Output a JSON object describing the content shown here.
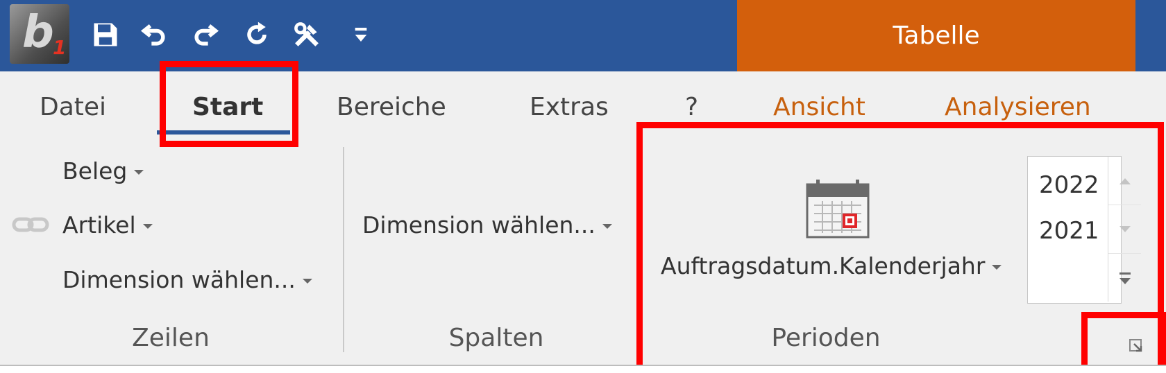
{
  "title_bar": {
    "logo_text": "b",
    "logo_sub": "1",
    "quick_access": [
      {
        "name": "save-icon"
      },
      {
        "name": "undo-icon"
      },
      {
        "name": "redo-icon"
      },
      {
        "name": "refresh-icon"
      },
      {
        "name": "tools-icon"
      },
      {
        "name": "customize-qat-icon"
      }
    ],
    "context_tab": "Tabelle"
  },
  "ribbon_tabs": [
    "Datei",
    "Start",
    "Bereiche",
    "Extras",
    "?",
    "Ansicht",
    "Analysieren"
  ],
  "active_tab": "Start",
  "groups": {
    "zeilen": {
      "title": "Zeilen",
      "items": [
        "Beleg",
        "Artikel",
        "Dimension wählen..."
      ]
    },
    "spalten": {
      "title": "Spalten",
      "items": [
        "Dimension wählen..."
      ]
    },
    "perioden": {
      "title": "Perioden",
      "dropdown": "Auftragsdatum.Kalenderjahr",
      "years": [
        "2022",
        "2021"
      ]
    }
  },
  "colors": {
    "title_bar": "#2b579a",
    "context_tab": "#d35f0c",
    "highlight": "#ff0000"
  }
}
